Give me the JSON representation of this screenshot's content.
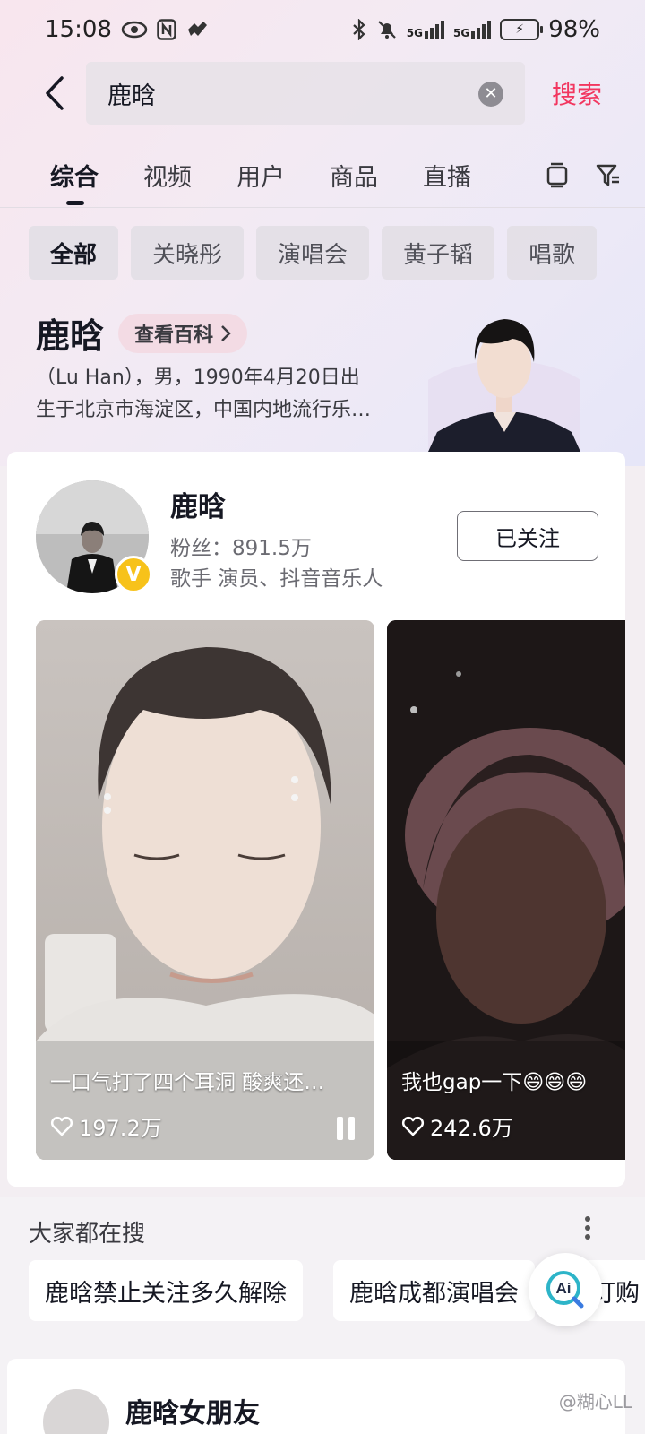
{
  "status_bar": {
    "time": "15:08",
    "battery": "98%",
    "net1": "5G",
    "net2": "5G"
  },
  "search": {
    "query": "鹿晗",
    "submit_label": "搜索"
  },
  "tabs": [
    "综合",
    "视频",
    "用户",
    "商品",
    "直播"
  ],
  "chips": [
    "全部",
    "关晓彤",
    "演唱会",
    "黄子韬",
    "唱歌"
  ],
  "baike": {
    "name": "鹿晗",
    "link_label": "查看百科",
    "desc_line1": "（Lu Han），男，1990年4月20日出",
    "desc_line2": "生于北京市海淀区，中国内地流行乐…"
  },
  "user_card": {
    "name": "鹿晗",
    "fans_label": "粉丝：891.5万",
    "tags": "歌手 演员、抖音音乐人",
    "follow_label": "已关注",
    "verify_mark": "V"
  },
  "videos": [
    {
      "caption": "一口气打了四个耳洞 酸爽还…",
      "likes": "197.2万"
    },
    {
      "caption": "我也gap一下😄😄😄",
      "likes": "242.6万"
    }
  ],
  "trending": {
    "title": "大家都在搜",
    "items": [
      "鹿晗禁止关注多久解除",
      "鹿晗成都演唱会",
      "订购"
    ]
  },
  "ai_label": "Ai",
  "next_card_title": "鹿晗女朋友",
  "watermark": "@糊心LL",
  "colors": {
    "accent": "#f2365f",
    "badge": "#f7c21a"
  }
}
